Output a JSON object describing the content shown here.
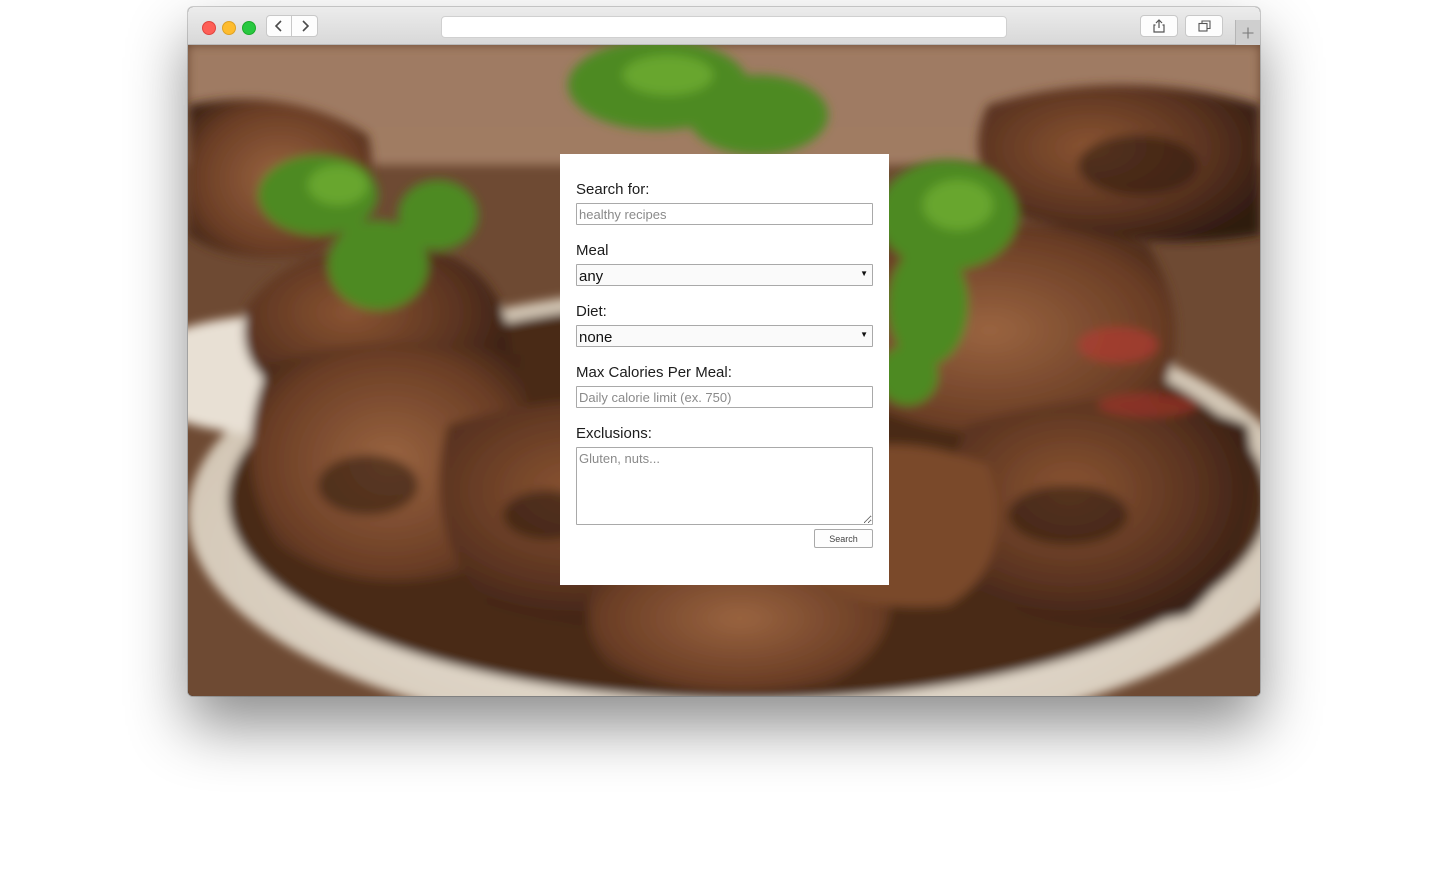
{
  "browser": {
    "address_text": "",
    "traffic_light_colors": {
      "close": "#fe5f57",
      "minimize": "#febc2e",
      "zoom": "#28c840"
    }
  },
  "form": {
    "search": {
      "label": "Search for:",
      "placeholder": "healthy recipes"
    },
    "meal": {
      "label": "Meal",
      "selected": "any"
    },
    "diet": {
      "label": "Diet:",
      "selected": "none"
    },
    "calories": {
      "label": "Max Calories Per Meal:",
      "placeholder": "Daily calorie limit (ex. 750)"
    },
    "exclusions": {
      "label": "Exclusions:",
      "placeholder": "Gluten, nuts..."
    },
    "submit_label": "Search"
  },
  "icons": {
    "back": "chevron-left-icon",
    "forward": "chevron-right-icon",
    "share": "share-icon",
    "tabs": "tabs-overview-icon",
    "new_tab": "plus-icon"
  },
  "background": {
    "subject": "grilled meat with parsley on a plate"
  }
}
